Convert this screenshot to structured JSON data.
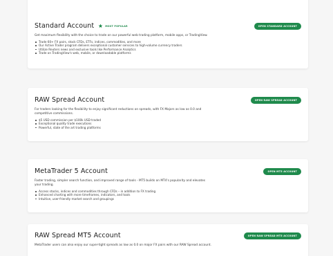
{
  "colors": {
    "accent": "#1f8a4c",
    "background": "#f6f6f6",
    "card": "#ffffff"
  },
  "cards": [
    {
      "title": "Standard Account",
      "badge": {
        "icon": "star-icon",
        "label": "MOST POPULAR"
      },
      "button_label": "OPEN STANDARD ACCOUNT",
      "description": "Get maximum flexibility with the choice to trade on our powerful web trading platform, mobile apps, or TradingView.",
      "features": [
        "Trade 60+ FX pairs, stock CFDs, ETFs, indices, commodities, and more",
        "Our Active Trader program delivers exceptional customer services to high-volume currency traders",
        "Utilize Reuters news and exclusive tools like Performance Analytics",
        "Trade on TradingView's web, mobile, or downloadable platforms"
      ]
    },
    {
      "title": "RAW Spread Account",
      "button_label": "OPEN RAW SPREAD ACCOUNT",
      "description": "For traders looking for the flexibility to enjoy significant reductions on spreads, with FX Majors as low as 0.0 and competitive commissions.",
      "features": [
        "$5 USD commission per $100k USD traded",
        "Exceptional quality trade executions",
        "Powerful, state of the art trading platforms"
      ]
    },
    {
      "title": "MetaTrader 5 Account",
      "button_label": "OPEN MT5 ACCOUNT",
      "description": "Faster trading, simpler search function, and improved range of tools - MT5 builds on MT4's popularity and elevates your trading.",
      "features": [
        "Access stocks, indices and commodities through CFDs – in addition to FX trading",
        "Enhanced charting with more timeframes, indicators, and tools",
        "Intuitive, user-friendly market search and groupings"
      ]
    },
    {
      "title": "RAW Spread MT5 Account",
      "button_label": "OPEN RAW SPREAD MT5 ACCOUNT",
      "description": "MetaTrader users can also enjoy our super-tight spreads as low as 0.0 on major FX pairs with our RAW Spread account.",
      "features": []
    }
  ]
}
